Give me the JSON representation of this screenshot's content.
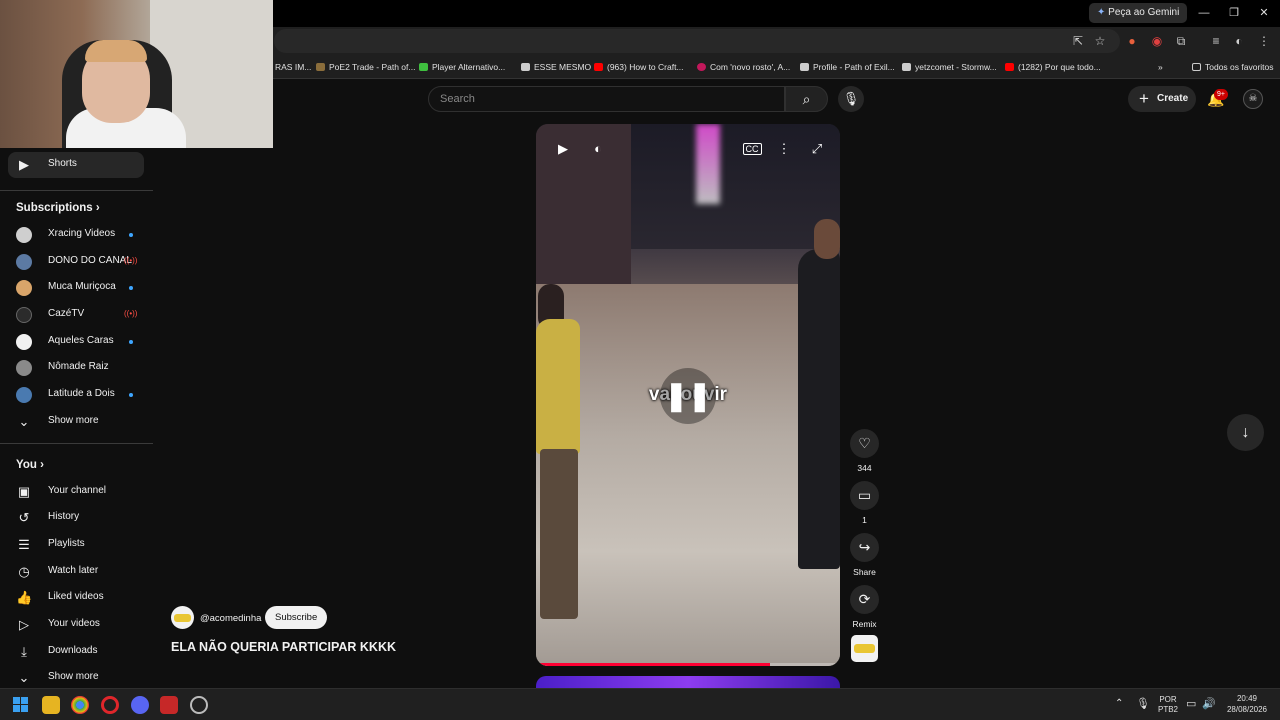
{
  "browser": {
    "gemini_label": "Peça ao Gemini",
    "bookmarks": [
      {
        "label": "RAS IM...",
        "color": "#555"
      },
      {
        "label": "PoE2 Trade - Path of...",
        "color": "#8a6d3b"
      },
      {
        "label": "Player Alternativo...",
        "color": "#3fbf3f"
      },
      {
        "label": "ESSE MESMO",
        "color": "#cccccc"
      },
      {
        "label": "(963) How to Craft...",
        "color": "#ff0000"
      },
      {
        "label": "Com 'novo rosto', A...",
        "color": "#c2185b"
      },
      {
        "label": "Profile - Path of Exil...",
        "color": "#cccccc"
      },
      {
        "label": "yetzcomet - Stormw...",
        "color": "#cccccc"
      },
      {
        "label": "(1282) Por que todo...",
        "color": "#ff0000"
      }
    ],
    "all_bookmarks": "Todos os favoritos"
  },
  "masthead": {
    "search_placeholder": "Search",
    "create_label": "Create",
    "notifications_badge": "9+"
  },
  "sidebar": {
    "shorts_label": "Shorts",
    "subscriptions_header": "Subscriptions",
    "subscriptions": [
      {
        "label": "Xracing Videos",
        "status": "dot",
        "avatar_color": "#cfcfcf"
      },
      {
        "label": "DONO DO CANAL",
        "status": "live",
        "avatar_color": "#5c7aa3"
      },
      {
        "label": "Muca Muriçoca",
        "status": "dot",
        "avatar_color": "#d9a56a"
      },
      {
        "label": "CazéTV",
        "status": "live",
        "avatar_color": "#2b2b2b"
      },
      {
        "label": "Aqueles Caras",
        "status": "dot",
        "avatar_color": "#f1f1f1"
      },
      {
        "label": "Nômade Raiz",
        "status": "none",
        "avatar_color": "#8a8a8a"
      },
      {
        "label": "Latitude a Dois",
        "status": "dot",
        "avatar_color": "#4a7ab0"
      }
    ],
    "show_more_1": "Show more",
    "you_header": "You",
    "you_items": [
      {
        "label": "Your channel",
        "icon": "person-box-icon"
      },
      {
        "label": "History",
        "icon": "history-icon"
      },
      {
        "label": "Playlists",
        "icon": "playlists-icon"
      },
      {
        "label": "Watch later",
        "icon": "clock-icon"
      },
      {
        "label": "Liked videos",
        "icon": "thumbs-up-icon"
      },
      {
        "label": "Your videos",
        "icon": "video-icon"
      },
      {
        "label": "Downloads",
        "icon": "download-icon"
      }
    ],
    "show_more_2": "Show more",
    "live_glyph": "((•))"
  },
  "short": {
    "caption": "vai ouvir",
    "progress": 0.77,
    "channel_handle": "@acomedinha",
    "subscribe_label": "Subscribe",
    "title": "ELA NÃO QUERIA PARTICIPAR KKKK",
    "likes": "344",
    "comments": "1",
    "share_label": "Share",
    "remix_label": "Remix"
  },
  "taskbar": {
    "lang_1": "POR",
    "lang_2": "PTB2",
    "time": "20:49",
    "date": "28/08/2026"
  }
}
